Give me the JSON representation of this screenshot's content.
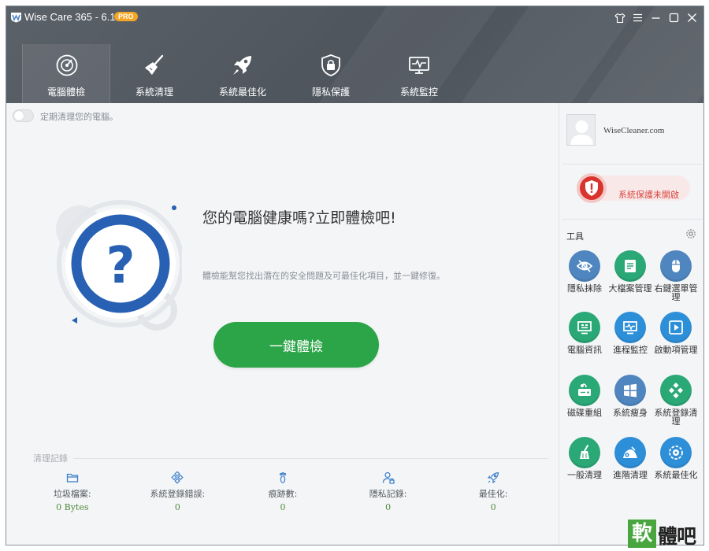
{
  "window": {
    "title": "Wise Care 365 - 6.1.2",
    "badge": "PRO"
  },
  "nav": {
    "tabs": [
      {
        "label": "電腦體檢",
        "icon": "health-check-icon",
        "active": true
      },
      {
        "label": "系統清理",
        "icon": "broom-icon",
        "active": false
      },
      {
        "label": "系統最佳化",
        "icon": "rocket-icon",
        "active": false
      },
      {
        "label": "隱私保護",
        "icon": "lock-icon",
        "active": false
      },
      {
        "label": "系統監控",
        "icon": "monitor-icon",
        "active": false
      }
    ]
  },
  "main": {
    "auto_clean_label": "定期清理您的電腦。",
    "headline": "您的電腦健康嗎?立即體檢吧!",
    "subline": "體檢能幫您找出潛在的安全問題及可最佳化項目，並一鍵修復。",
    "check_button": "一鍵體檢",
    "history_title": "清理記錄",
    "stats": [
      {
        "label": "垃圾檔案:",
        "value": "0 Bytes",
        "icon": "folder-icon"
      },
      {
        "label": "系統登錄錯誤:",
        "value": "0",
        "icon": "registry-icon"
      },
      {
        "label": "痕跡數:",
        "value": "0",
        "icon": "footprint-icon"
      },
      {
        "label": "隱私記錄:",
        "value": "0",
        "icon": "user-privacy-icon"
      },
      {
        "label": "最佳化:",
        "value": "0",
        "icon": "rocket-small-icon"
      }
    ]
  },
  "side": {
    "site": "WiseCleaner.com",
    "protection_status": "系統保護未開啟",
    "tools_title": "工具",
    "tools": [
      {
        "label": "隱私抹除",
        "icon": "eye-off-icon",
        "color": "#4f86bf"
      },
      {
        "label": "大檔案管理",
        "icon": "large-file-icon",
        "color": "#2aa876"
      },
      {
        "label": "右鍵選單管理",
        "icon": "mouse-icon",
        "color": "#4f86bf"
      },
      {
        "label": "電腦資訊",
        "icon": "computer-info-icon",
        "color": "#2aa876"
      },
      {
        "label": "進程監控",
        "icon": "process-monitor-icon",
        "color": "#2d8fd8"
      },
      {
        "label": "啟動項管理",
        "icon": "startup-icon",
        "color": "#2d8fd8"
      },
      {
        "label": "磁碟重組",
        "icon": "disk-defrag-icon",
        "color": "#2aa876"
      },
      {
        "label": "系統瘦身",
        "icon": "windows-icon",
        "color": "#4f86bf"
      },
      {
        "label": "系統登錄清理",
        "icon": "registry-clean-icon",
        "color": "#2aa876"
      },
      {
        "label": "一般清理",
        "icon": "broom-tool-icon",
        "color": "#2aa876"
      },
      {
        "label": "進階清理",
        "icon": "advanced-clean-icon",
        "color": "#2d8fd8"
      },
      {
        "label": "系統最佳化",
        "icon": "optimize-icon",
        "color": "#2d8fd8"
      }
    ]
  },
  "watermark": {
    "box": "軟",
    "text": "體吧"
  }
}
